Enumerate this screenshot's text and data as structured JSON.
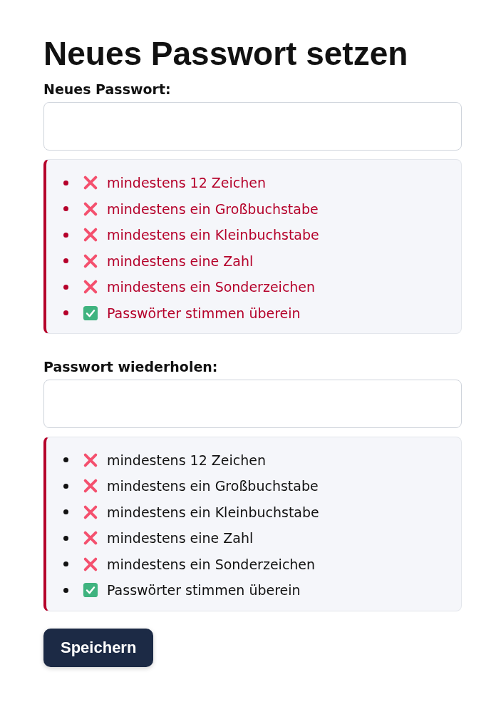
{
  "title": "Neues Passwort setzen",
  "fields": [
    {
      "label": "Neues Passwort:",
      "checklist": {
        "error": true,
        "items": [
          {
            "text": "mindestens 12 Zeichen",
            "met": false
          },
          {
            "text": "mindestens ein Großbuchstabe",
            "met": false
          },
          {
            "text": "mindestens ein Kleinbuchstabe",
            "met": false
          },
          {
            "text": "mindestens eine Zahl",
            "met": false
          },
          {
            "text": "mindestens ein Sonderzeichen",
            "met": false
          },
          {
            "text": "Passwörter stimmen überein",
            "met": true
          }
        ]
      }
    },
    {
      "label": "Passwort wiederholen:",
      "checklist": {
        "error": false,
        "items": [
          {
            "text": "mindestens 12 Zeichen",
            "met": false
          },
          {
            "text": "mindestens ein Großbuchstabe",
            "met": false
          },
          {
            "text": "mindestens ein Kleinbuchstabe",
            "met": false
          },
          {
            "text": "mindestens eine Zahl",
            "met": false
          },
          {
            "text": "mindestens ein Sonderzeichen",
            "met": false
          },
          {
            "text": "Passwörter stimmen überein",
            "met": true
          }
        ]
      }
    }
  ],
  "save_button": {
    "label": "Speichern"
  }
}
